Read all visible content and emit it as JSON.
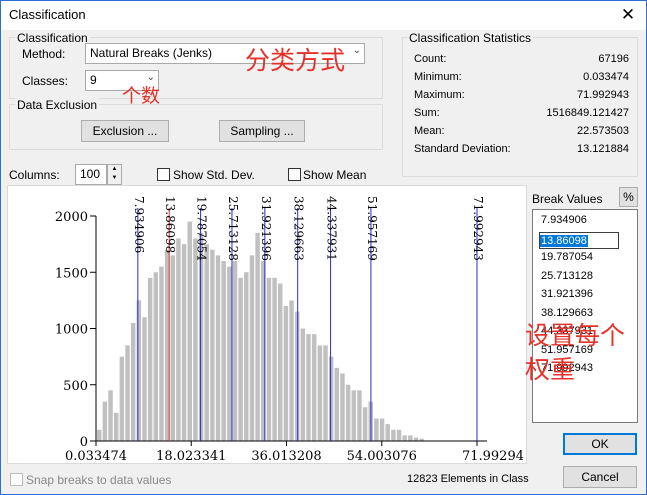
{
  "window": {
    "title": "Classification",
    "close_glyph": "✕"
  },
  "classification": {
    "group_title": "Classification",
    "method_label": "Method:",
    "method_value": "Natural Breaks (Jenks)",
    "classes_label": "Classes:",
    "classes_value": "9"
  },
  "annotations": {
    "method_note": "分类方式",
    "classes_note": "个数",
    "weights_note": "设置每个\n权重"
  },
  "exclusion": {
    "group_title": "Data Exclusion",
    "exclusion_button": "Exclusion ...",
    "sampling_button": "Sampling ..."
  },
  "statistics": {
    "group_title": "Classification Statistics",
    "rows": [
      {
        "label": "Count:",
        "value": "67196"
      },
      {
        "label": "Minimum:",
        "value": "0.033474"
      },
      {
        "label": "Maximum:",
        "value": "71.992943"
      },
      {
        "label": "Sum:",
        "value": "1516849.121427"
      },
      {
        "label": "Mean:",
        "value": "22.573503"
      },
      {
        "label": "Standard Deviation:",
        "value": "13.121884"
      }
    ]
  },
  "histogram_controls": {
    "columns_label": "Columns:",
    "columns_value": "100",
    "show_std_dev": "Show Std. Dev.",
    "show_mean": "Show Mean"
  },
  "break_values": {
    "title": "Break Values",
    "percent_button": "%",
    "values": [
      "7.934906",
      "13.86098",
      "19.787054",
      "25.713128",
      "31.921396",
      "38.129663",
      "44.337931",
      "51.957169",
      "71.992943"
    ],
    "selected_index": 1
  },
  "footer": {
    "snap_label": "Snap breaks to data values",
    "elements_in_class": "12823 Elements in Class",
    "ok_button": "OK",
    "cancel_button": "Cancel"
  },
  "chart_data": {
    "type": "bar",
    "title": "",
    "xlabel": "",
    "ylabel": "",
    "xlim": [
      0.033474,
      71.992943
    ],
    "ylim": [
      0,
      2000
    ],
    "x_ticks": [
      "0.033474",
      "18.023341",
      "36.013208",
      "54.003076",
      "71.99294"
    ],
    "x_tick_values": [
      0.033474,
      18.023341,
      36.013208,
      54.003076,
      71.992943
    ],
    "y_ticks": [
      0,
      500,
      1000,
      1500,
      2000
    ],
    "bar_values": [
      100,
      350,
      450,
      250,
      750,
      850,
      1050,
      1250,
      1100,
      1450,
      1500,
      1550,
      1700,
      1650,
      1800,
      1750,
      1950,
      1800,
      1850,
      1750,
      1700,
      1650,
      1600,
      1550,
      1600,
      1450,
      1500,
      1650,
      1850,
      1600,
      1450,
      1450,
      1400,
      1200,
      1250,
      1150,
      1000,
      950,
      950,
      850,
      850,
      750,
      650,
      600,
      500,
      450,
      450,
      300,
      350,
      200,
      200,
      150,
      100,
      100,
      50,
      50,
      30,
      20
    ],
    "break_values": [
      7.934906,
      13.86098,
      19.787054,
      25.713128,
      31.921396,
      38.129663,
      44.337931,
      51.957169,
      71.992943
    ],
    "break_labels": [
      "7.934906",
      "13.86098",
      "19.787054",
      "25.713128",
      "31.921396",
      "38.129663",
      "44.337931",
      "51.957169",
      "71.992943"
    ],
    "selected_break_index": 1,
    "bar_color": "#c0c0c0",
    "break_color": "#2b2bd6",
    "selected_break_color": "#e03030"
  }
}
